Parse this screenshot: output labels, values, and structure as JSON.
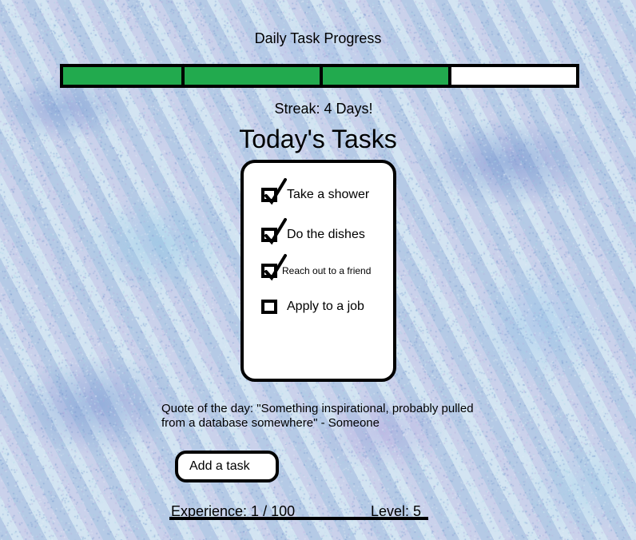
{
  "header": {
    "progress_title": "Daily Task Progress",
    "progress": {
      "completed_segments": 3,
      "total_segments": 4,
      "segment_fractions": [
        0.237,
        0.27,
        0.25,
        0.243
      ]
    },
    "streak": "Streak: 4 Days!"
  },
  "tasks": {
    "heading": "Today's Tasks",
    "items": [
      {
        "label": "Take a shower",
        "checked": true,
        "size": "normal"
      },
      {
        "label": "Do the dishes",
        "checked": true,
        "size": "normal"
      },
      {
        "label": "Reach out to a friend",
        "checked": true,
        "size": "small"
      },
      {
        "label": "Apply to a job",
        "checked": false,
        "size": "normal"
      }
    ]
  },
  "quote": {
    "text": "Quote of the day: \"Something inspirational, probably pulled from a database somewhere\" - Someone"
  },
  "add_task": {
    "label": "Add a task"
  },
  "footer": {
    "experience": "Experience: 1 / 100",
    "level": "Level: 5"
  },
  "colors": {
    "progress_fill": "#22aa4e",
    "background": "#d8e6f3"
  }
}
